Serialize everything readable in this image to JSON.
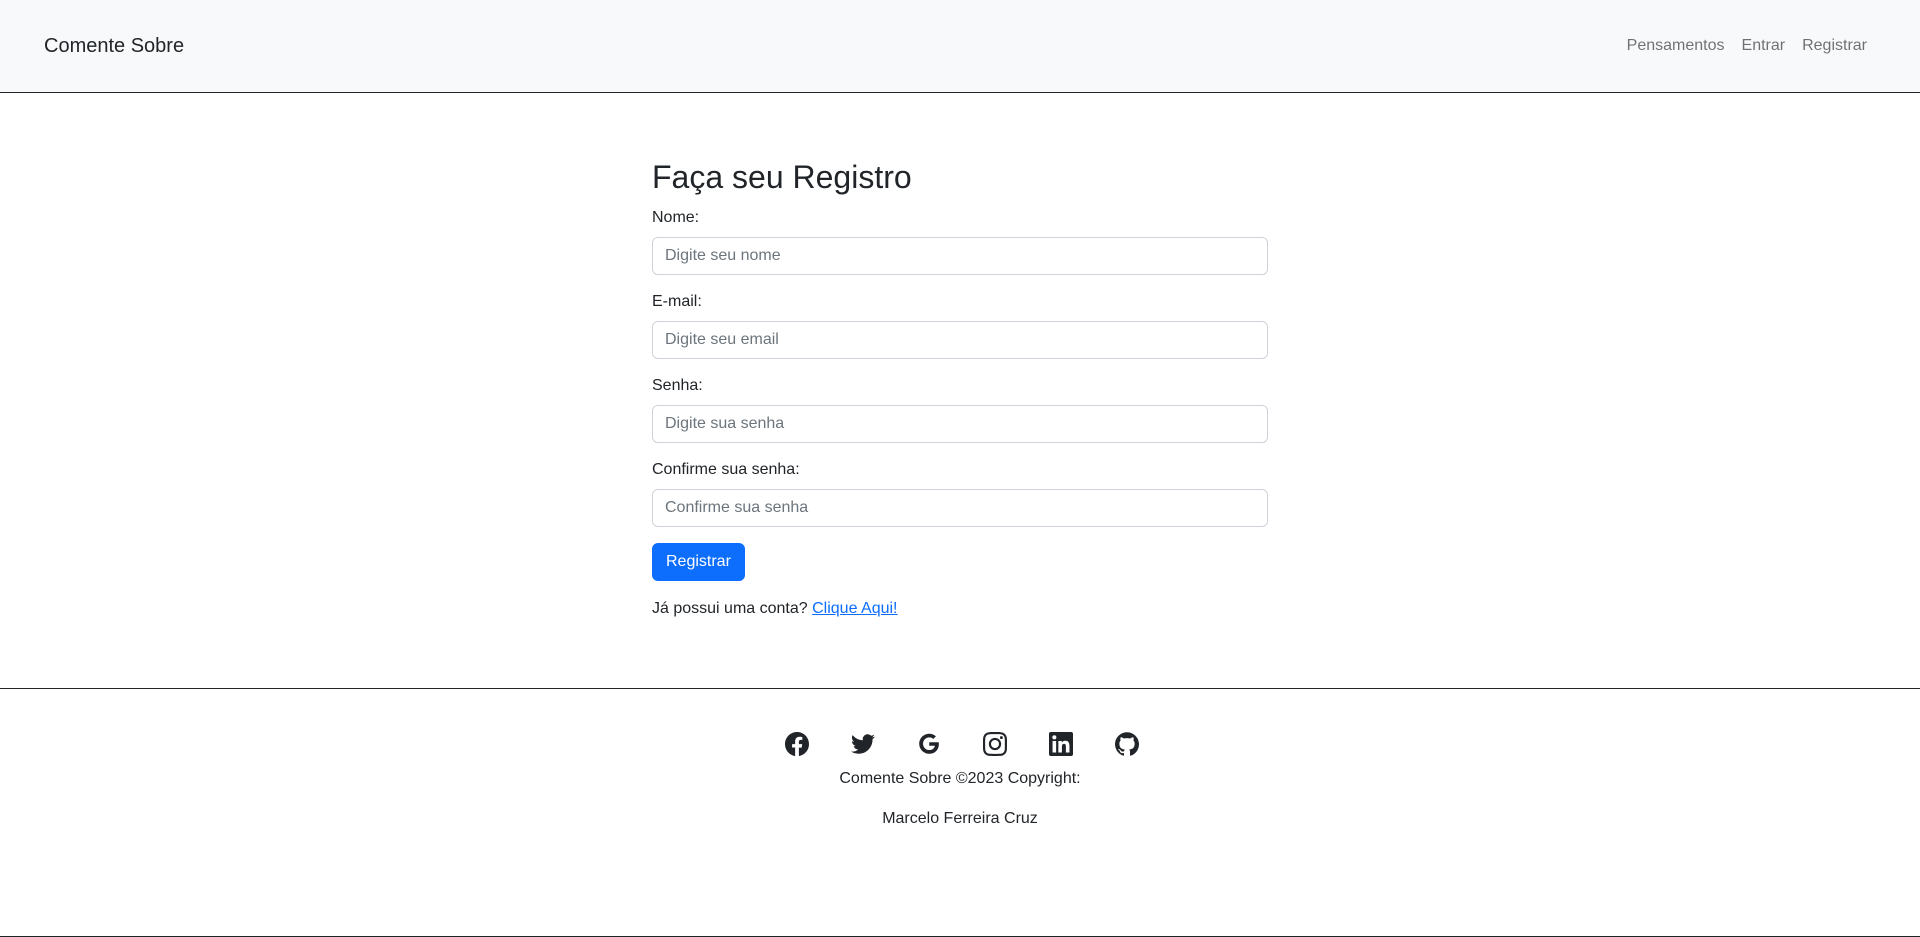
{
  "navbar": {
    "brand": "Comente Sobre",
    "links": [
      "Pensamentos",
      "Entrar",
      "Registrar"
    ]
  },
  "form": {
    "title": "Faça seu Registro",
    "fields": [
      {
        "label": "Nome:",
        "placeholder": "Digite seu nome"
      },
      {
        "label": "E-mail:",
        "placeholder": "Digite seu email"
      },
      {
        "label": "Senha:",
        "placeholder": "Digite sua senha"
      },
      {
        "label": "Confirme sua senha:",
        "placeholder": "Confirme sua senha"
      }
    ],
    "submit_label": "Registrar",
    "login_prompt": "Já possui uma conta?",
    "login_link": "Clique Aqui!"
  },
  "footer": {
    "social_icons": [
      "facebook-icon",
      "twitter-icon",
      "google-icon",
      "instagram-icon",
      "linkedin-icon",
      "github-icon"
    ],
    "copyright": "Comente Sobre ©2023 Copyright:",
    "author": "Marcelo Ferreira Cruz"
  },
  "colors": {
    "primary": "#0d6efd",
    "navbar_bg": "#f8f9fa",
    "text": "#212529"
  }
}
